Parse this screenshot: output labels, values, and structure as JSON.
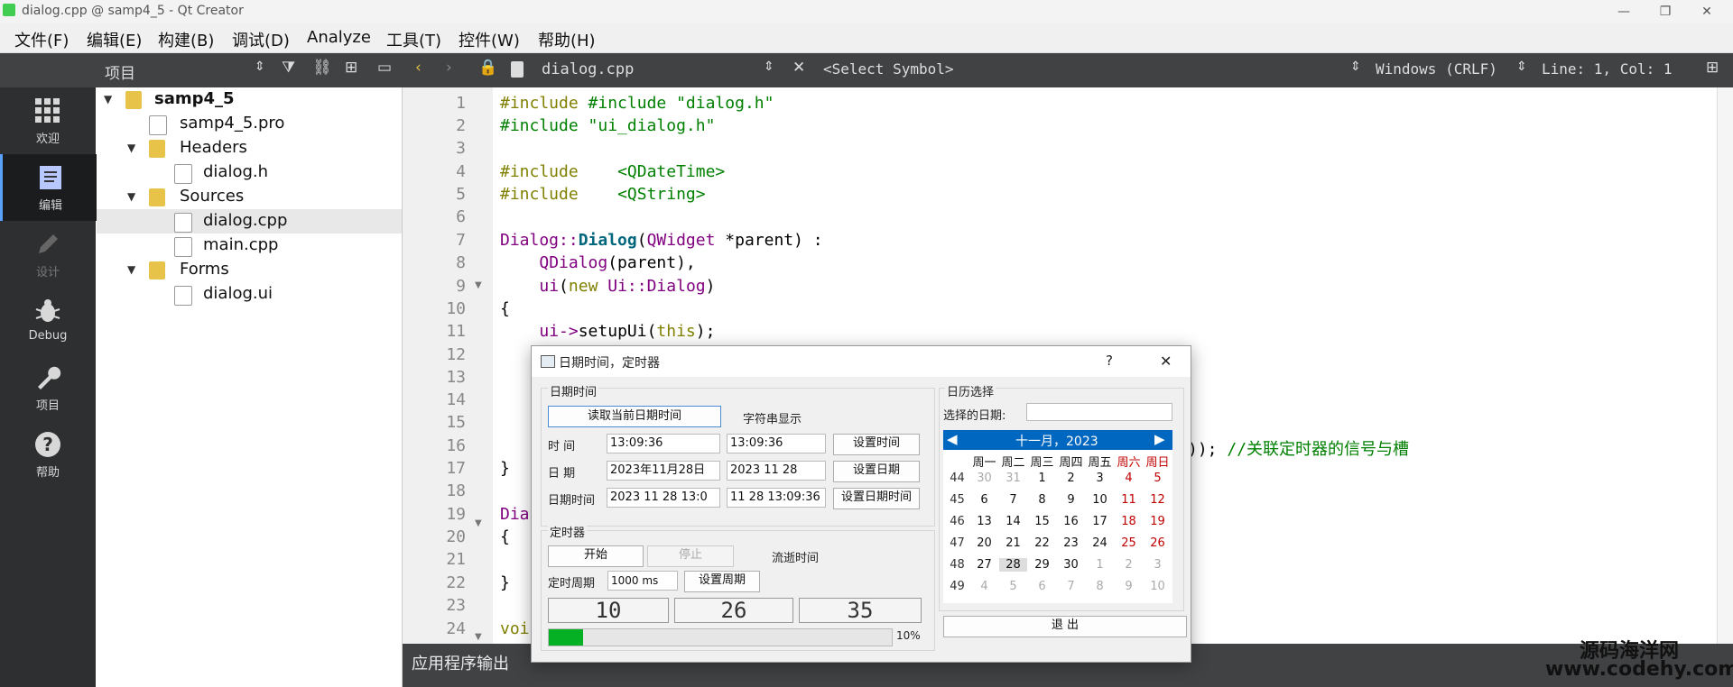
{
  "window": {
    "title": "dialog.cpp @ samp4_5 - Qt Creator",
    "min": "—",
    "max": "❐",
    "close": "✕"
  },
  "menu": [
    "文件(F)",
    "编辑(E)",
    "构建(B)",
    "调试(D)",
    "Analyze",
    "工具(T)",
    "控件(W)",
    "帮助(H)"
  ],
  "toolbar": {
    "panel_label": "项目",
    "file_name": "dialog.cpp",
    "symbol": "<Select Symbol>",
    "line_ending": "Windows (CRLF)",
    "position": "Line: 1, Col: 1"
  },
  "sidebar": [
    {
      "label": "欢迎",
      "icon": "grid-icon"
    },
    {
      "label": "编辑",
      "icon": "edit-doc-icon"
    },
    {
      "label": "设计",
      "icon": "pencil-icon"
    },
    {
      "label": "Debug",
      "icon": "bug-icon"
    },
    {
      "label": "项目",
      "icon": "wrench-icon"
    },
    {
      "label": "帮助",
      "icon": "help-icon"
    }
  ],
  "tree": [
    {
      "label": "samp4_5",
      "depth": 0,
      "arrow": "▾",
      "bold": true
    },
    {
      "label": "samp4_5.pro",
      "depth": 1,
      "arrow": ""
    },
    {
      "label": "Headers",
      "depth": 1,
      "arrow": "▾"
    },
    {
      "label": "dialog.h",
      "depth": 2,
      "arrow": ""
    },
    {
      "label": "Sources",
      "depth": 1,
      "arrow": "▾"
    },
    {
      "label": "dialog.cpp",
      "depth": 2,
      "arrow": "",
      "selected": true
    },
    {
      "label": "main.cpp",
      "depth": 2,
      "arrow": ""
    },
    {
      "label": "Forms",
      "depth": 1,
      "arrow": "▾"
    },
    {
      "label": "dialog.ui",
      "depth": 2,
      "arrow": ""
    }
  ],
  "code_lines": [
    "1",
    "2",
    "3",
    "4",
    "5",
    "6",
    "7",
    "8",
    "9",
    "10",
    "11",
    "12",
    "13",
    "14",
    "15",
    "16",
    "17",
    "18",
    "19",
    "20",
    "21",
    "22",
    "23",
    "24"
  ],
  "code": {
    "l1": "#include \"dialog.h\"",
    "l2": "#include \"ui_dialog.h\"",
    "l4a": "#include",
    "l4b": "<QDateTime>",
    "l5a": "#include",
    "l5b": "<QString>",
    "l7a": "Dialog::",
    "l7b": "Dialog",
    "l7c": "(",
    "l7d": "QWidget",
    "l7e": " *parent) :",
    "l8a": "QDialog",
    "l8b": "(parent),",
    "l9a": "ui",
    "l9b": "(",
    "l9c": "new",
    "l9d": " Ui::",
    "l9e": "Dialog",
    ")": ")",
    "l10": "{",
    "l11a": "ui->",
    "l11b": "setupUi",
    "l11c": "(",
    "l11d": "this",
    "l11e": ");",
    "l16a": "));",
    "l16b": "//关联定时器的信号与槽",
    "l17": "}",
    "l19": "Dia",
    "l20": "{",
    "l22": "}",
    "l24": "voi"
  },
  "output_label": "应用程序输出",
  "dialog": {
    "title": "日期时间，定时器",
    "help": "?",
    "close": "✕",
    "g1_title": "日期时间",
    "read_btn": "读取当前日期时间",
    "str_label": "字符串显示",
    "time_label": "时    间",
    "time_value": "13:09:36",
    "time_str": "13:09:36",
    "set_time": "设置时间",
    "date_label": "日    期",
    "date_value": "2023年11月28日",
    "date_str": "2023 11 28",
    "set_date": "设置日期",
    "dt_label": "日期时间",
    "dt_value": "2023 11 28 13:0",
    "dt_str": "11 28 13:09:36",
    "set_dt": "设置日期时间",
    "g2_title": "定时器",
    "start": "开始",
    "stop": "停止",
    "elapsed": "流逝时间",
    "period_label": "定时周期",
    "period_value": "1000 ms",
    "set_period": "设置周期",
    "lcd": [
      "10",
      "26",
      "35"
    ],
    "progress": 0.1,
    "progress_text": "10%",
    "g3_title": "日历选择",
    "sel_label": "选择的日期:",
    "month": "十一月，2023",
    "weekdays": [
      "周一",
      "周二",
      "周三",
      "周四",
      "周五",
      "周六",
      "周日"
    ],
    "weeks": [
      {
        "wk": "44",
        "days": [
          "30",
          "31",
          "1",
          "2",
          "3",
          "4",
          "5"
        ]
      },
      {
        "wk": "45",
        "days": [
          "6",
          "7",
          "8",
          "9",
          "10",
          "11",
          "12"
        ]
      },
      {
        "wk": "46",
        "days": [
          "13",
          "14",
          "15",
          "16",
          "17",
          "18",
          "19"
        ]
      },
      {
        "wk": "47",
        "days": [
          "20",
          "21",
          "22",
          "23",
          "24",
          "25",
          "26"
        ]
      },
      {
        "wk": "48",
        "days": [
          "27",
          "28",
          "29",
          "30",
          "1",
          "2",
          "3"
        ]
      },
      {
        "wk": "49",
        "days": [
          "4",
          "5",
          "6",
          "7",
          "8",
          "9",
          "10"
        ]
      }
    ],
    "exit": "退  出"
  },
  "watermark": {
    "line1": "源码海洋网",
    "line2": "www.codehy.com"
  }
}
